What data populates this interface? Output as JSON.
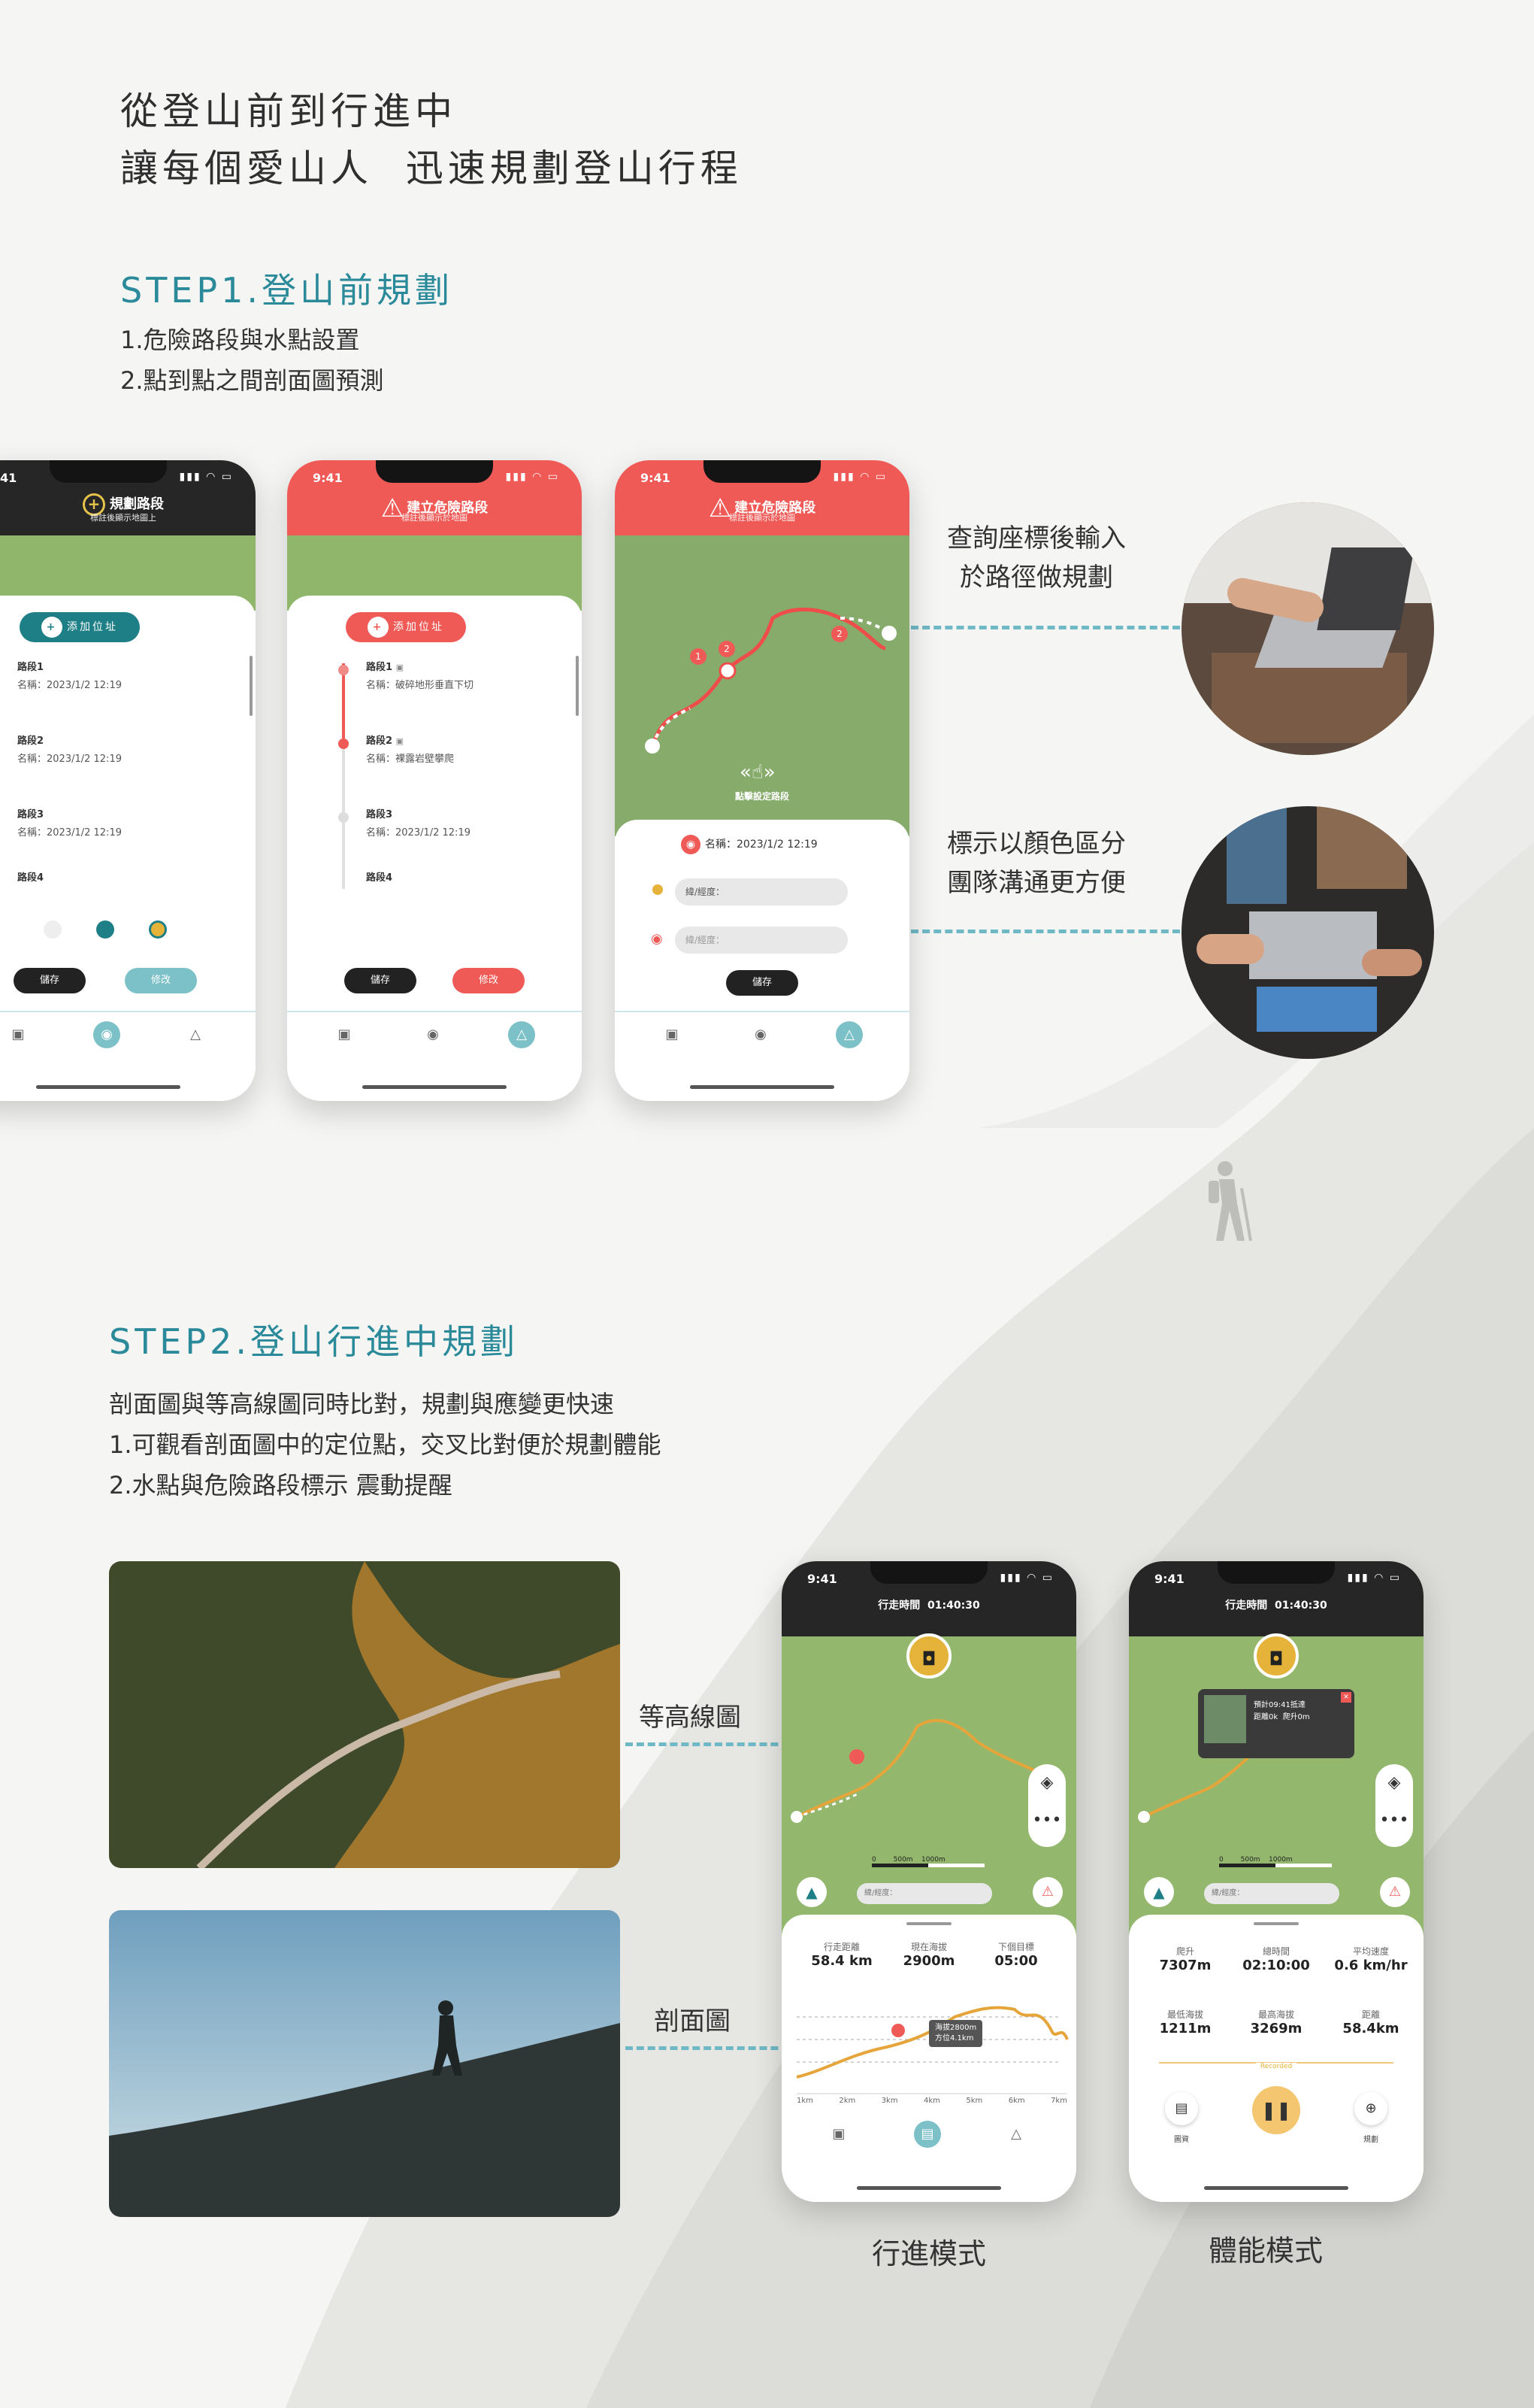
{
  "hero": {
    "line1": "從登山前到行進中",
    "line2": "讓每個愛山人  迅速規劃登山行程"
  },
  "step1": {
    "title": "STEP1.登山前規劃",
    "items": [
      "1.危險路段與水點設置",
      "2.點到點之間剖面圖預測"
    ]
  },
  "step2": {
    "title": "STEP2.登山行進中規劃",
    "items": [
      "剖面圖與等高線圖同時比對，規劃與應變更快速",
      "1.可觀看剖面圖中的定位點，交叉比對便於規劃體能",
      "2.水點與危險路段標示 震動提醒"
    ]
  },
  "colors": {
    "accent": "#2a8a9a",
    "danger": "#ef5a56",
    "dark": "#262626",
    "teal": "#1e7f86",
    "gold": "#e6b33a",
    "map": "#8fb66a"
  },
  "phone1": {
    "time": "41",
    "title": "規劃路段",
    "subtitle": "標註後顯示地圖上",
    "add_label": "添加位址",
    "segments": [
      {
        "name": "路段1",
        "detail": "名稱：2023/1/2 12:19"
      },
      {
        "name": "路段2",
        "detail": "名稱：2023/1/2 12:19"
      },
      {
        "name": "路段3",
        "detail": "名稱：2023/1/2 12:19"
      },
      {
        "name": "路段4",
        "detail": ""
      }
    ],
    "save": "儲存",
    "edit": "修改"
  },
  "phone2": {
    "time": "9:41",
    "title": "建立危險路段",
    "subtitle": "標註後顯示於地圖",
    "add_label": "添加位址",
    "segments": [
      {
        "name": "路段1",
        "detail": "名稱：破碎地形垂直下切"
      },
      {
        "name": "路段2",
        "detail": "名稱：裸露岩壁攀爬"
      },
      {
        "name": "路段3",
        "detail": "名稱：2023/1/2 12:19"
      },
      {
        "name": "路段4",
        "detail": ""
      }
    ],
    "save": "儲存",
    "edit": "修改"
  },
  "phone3": {
    "time": "9:41",
    "title": "建立危險路段",
    "subtitle": "標註後顯示於地圖",
    "hint": "點擊設定路段",
    "name_label": "名稱：2023/1/2 12:19",
    "coord_placeholder": "緯/經度：",
    "save": "儲存"
  },
  "side": {
    "text1a": "查詢座標後輸入",
    "text1b": "於路徑做規劃",
    "text2a": "標示以顏色區分",
    "text2b": "團隊溝通更方便"
  },
  "labels": {
    "contour": "等高線圖",
    "profile": "剖面圖"
  },
  "phone4": {
    "time": "9:41",
    "elapsed": "行走時間  01:40:30",
    "coord_placeholder": "緯/經度：",
    "scale": [
      "0",
      "500m",
      "1000m"
    ],
    "stats": [
      {
        "label": "行走距離",
        "value": "58.4 km"
      },
      {
        "label": "現在海拔",
        "value": "2900m"
      },
      {
        "label": "下個目標",
        "value": "05:00"
      }
    ],
    "tooltip": [
      "海拔2800m",
      "方位4.1km"
    ],
    "xticks": [
      "1km",
      "2km",
      "3km",
      "4km",
      "5km",
      "6km",
      "7km"
    ],
    "caption": "行進模式"
  },
  "phone5": {
    "time": "9:41",
    "elapsed": "行走時間  01:40:30",
    "popup": [
      "預計09:41抵達",
      "距離0k  爬升0m"
    ],
    "coord_placeholder": "緯/經度：",
    "scale": [
      "0",
      "500m",
      "1000m"
    ],
    "stats": [
      {
        "label": "爬升",
        "value": "7307m"
      },
      {
        "label": "總時間",
        "value": "02:10:00"
      },
      {
        "label": "平均速度",
        "value": "0.6 km/hr"
      },
      {
        "label": "最低海拔",
        "value": "1211m"
      },
      {
        "label": "最高海拔",
        "value": "3269m"
      },
      {
        "label": "距離",
        "value": "58.4km"
      }
    ],
    "recorded": "Recorded",
    "btn_left": "圖資",
    "btn_right": "規劃",
    "caption": "體能模式"
  }
}
